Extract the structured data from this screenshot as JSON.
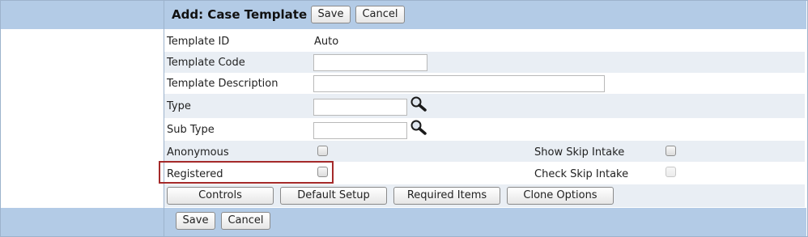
{
  "header": {
    "title": "Add: Case Template",
    "save_label": "Save",
    "cancel_label": "Cancel"
  },
  "form": {
    "template_id": {
      "label": "Template ID",
      "value": "Auto"
    },
    "template_code": {
      "label": "Template Code",
      "value": ""
    },
    "template_description": {
      "label": "Template Description",
      "value": ""
    },
    "type": {
      "label": "Type",
      "value": "",
      "lookup_icon": "magnifier-icon"
    },
    "sub_type": {
      "label": "Sub Type",
      "value": "",
      "lookup_icon": "magnifier-icon"
    },
    "anonymous": {
      "label": "Anonymous",
      "checked": false
    },
    "registered": {
      "label": "Registered",
      "checked": false
    },
    "show_skip_intake": {
      "label": "Show Skip Intake",
      "checked": false
    },
    "check_skip_intake": {
      "label": "Check Skip Intake",
      "checked": false,
      "disabled": true
    }
  },
  "action_buttons": {
    "controls": "Controls",
    "default_setup": "Default Setup",
    "required_items": "Required Items",
    "clone_options": "Clone Options"
  },
  "footer": {
    "save_label": "Save",
    "cancel_label": "Cancel"
  },
  "colors": {
    "header_bar": "#b3cbe6",
    "alt_row": "#e9eef4",
    "highlight_border": "#a52a2a"
  }
}
